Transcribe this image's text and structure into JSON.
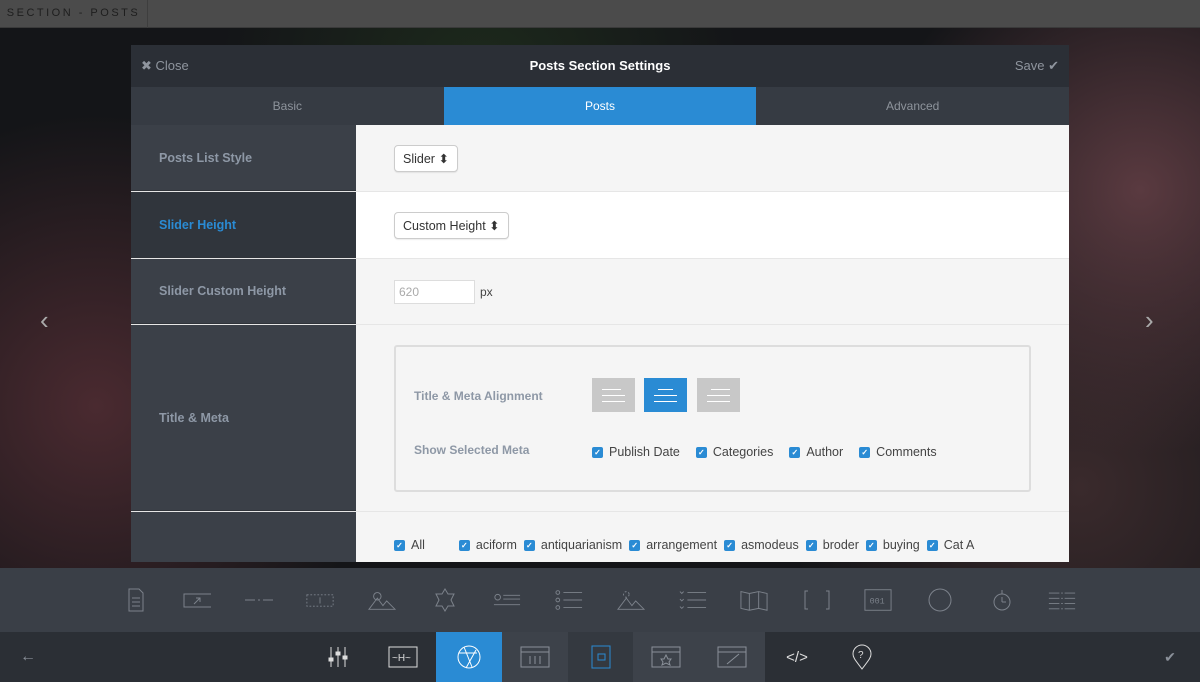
{
  "topbar": {
    "label": "SECTION - POSTS"
  },
  "modal": {
    "close": "Close",
    "title": "Posts Section Settings",
    "save": "Save",
    "tabs": [
      {
        "label": "Basic"
      },
      {
        "label": "Posts"
      },
      {
        "label": "Advanced"
      }
    ],
    "rows": {
      "list_style": {
        "label": "Posts List Style",
        "value": "Slider"
      },
      "slider_height": {
        "label": "Slider Height",
        "value": "Custom Height"
      },
      "custom_height": {
        "label": "Slider Custom Height",
        "value": "620",
        "unit": "px"
      },
      "title_meta": {
        "label": "Title & Meta",
        "alignment_label": "Title & Meta Alignment",
        "alignment_selected": "center",
        "meta_label": "Show Selected Meta",
        "meta": [
          {
            "label": "Publish Date",
            "checked": true
          },
          {
            "label": "Categories",
            "checked": true
          },
          {
            "label": "Author",
            "checked": true
          },
          {
            "label": "Comments",
            "checked": true
          }
        ]
      },
      "categories": [
        {
          "label": "All"
        },
        {
          "label": "aciform"
        },
        {
          "label": "antiquarianism"
        },
        {
          "label": "arrangement"
        },
        {
          "label": "asmodeus"
        },
        {
          "label": "broder"
        },
        {
          "label": "buying"
        },
        {
          "label": "Cat A"
        }
      ]
    }
  },
  "colors": {
    "accent": "#2a8bd4"
  }
}
